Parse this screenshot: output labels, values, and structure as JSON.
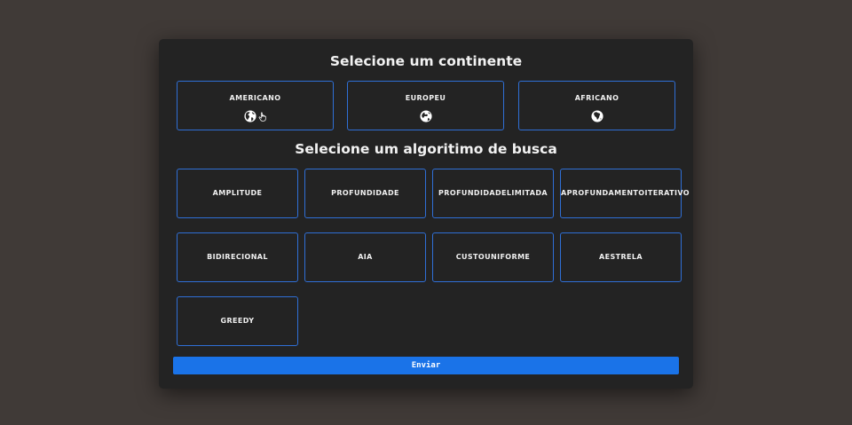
{
  "continent_section": {
    "title": "Selecione um continente",
    "options": [
      {
        "label": "AMERICANO",
        "icon": "globe-americas-icon"
      },
      {
        "label": "EUROPEU",
        "icon": "globe-europe-icon"
      },
      {
        "label": "AFRICANO",
        "icon": "globe-africa-icon"
      }
    ]
  },
  "algorithm_section": {
    "title": "Selecione um algoritimo de busca",
    "options": [
      "AMPLITUDE",
      "PROFUNDIDADE",
      "PROFUNDIDADELIMITADA",
      "APROFUNDAMENTOITERATIVO",
      "BIDIRECIONAL",
      "AIA",
      "CUSTOUNIFORME",
      "AESTRELA",
      "GREEDY"
    ]
  },
  "submit": {
    "label": "Enviar"
  },
  "colors": {
    "background": "#403a37",
    "card": "#232323",
    "border_accent": "#2f6fd6",
    "button": "#1a73e8",
    "text": "#f0f0f0"
  }
}
